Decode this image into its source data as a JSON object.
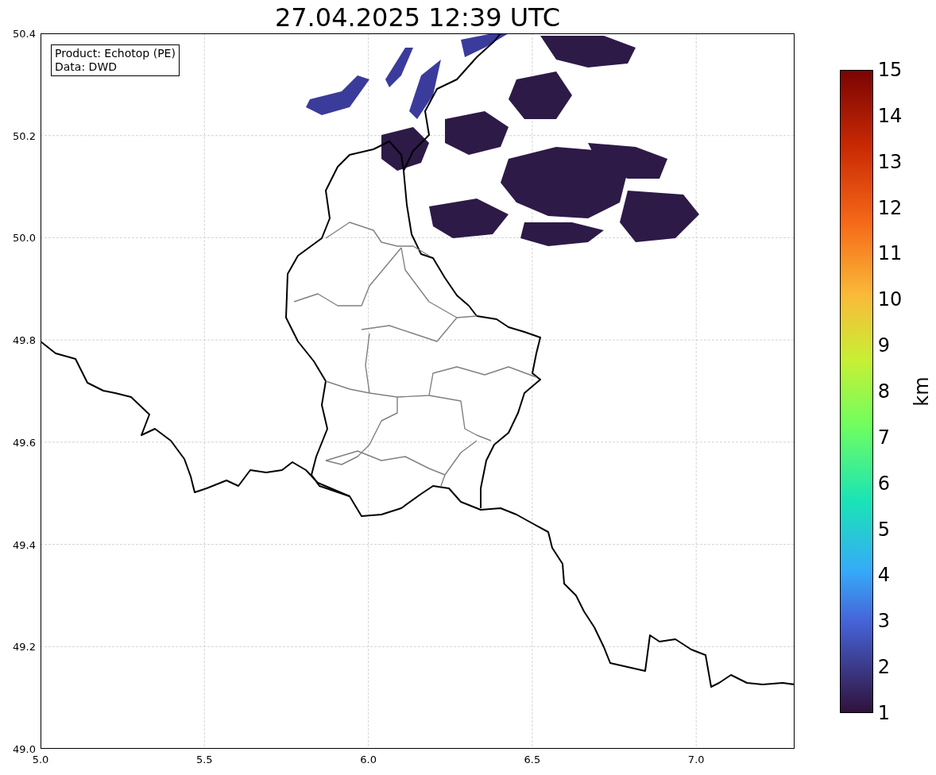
{
  "title": "27.04.2025 12:39 UTC",
  "info_box": [
    "Product: Echotop (PE)",
    "Data: DWD"
  ],
  "x_ticks": [
    "5.0",
    "5.5",
    "6.0",
    "6.5",
    "7.0"
  ],
  "y_ticks": [
    "50.4",
    "50.2",
    "50.0",
    "49.8",
    "49.6",
    "49.4",
    "49.2",
    "49.0"
  ],
  "colorbar": {
    "label": "km",
    "ticks": [
      "15",
      "14",
      "13",
      "12",
      "11",
      "10",
      "9",
      "8",
      "7",
      "6",
      "5",
      "4",
      "3",
      "2",
      "1"
    ]
  }
}
